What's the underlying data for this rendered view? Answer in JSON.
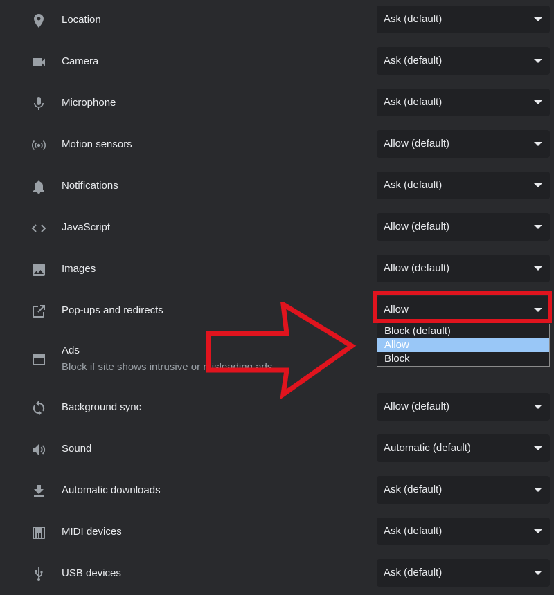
{
  "rows": [
    {
      "label": "Location",
      "value": "Ask (default)"
    },
    {
      "label": "Camera",
      "value": "Ask (default)"
    },
    {
      "label": "Microphone",
      "value": "Ask (default)"
    },
    {
      "label": "Motion sensors",
      "value": "Allow (default)"
    },
    {
      "label": "Notifications",
      "value": "Ask (default)"
    },
    {
      "label": "JavaScript",
      "value": "Allow (default)"
    },
    {
      "label": "Images",
      "value": "Allow (default)"
    },
    {
      "label": "Pop-ups and redirects",
      "value": "Allow"
    },
    {
      "label": "Ads",
      "sublabel": "Block if site shows intrusive or misleading ads"
    },
    {
      "label": "Background sync",
      "value": "Allow (default)"
    },
    {
      "label": "Sound",
      "value": "Automatic (default)"
    },
    {
      "label": "Automatic downloads",
      "value": "Ask (default)"
    },
    {
      "label": "MIDI devices",
      "value": "Ask (default)"
    },
    {
      "label": "USB devices",
      "value": "Ask (default)"
    }
  ],
  "popup_dropdown": {
    "options": [
      "Block (default)",
      "Allow",
      "Block"
    ],
    "selected": "Allow"
  },
  "icons": [
    "location-pin-icon",
    "camera-icon",
    "microphone-icon",
    "motion-sensors-icon",
    "bell-icon",
    "code-icon",
    "image-icon",
    "open-in-new-icon",
    "ads-window-icon",
    "sync-icon",
    "speaker-icon",
    "download-icon",
    "piano-icon",
    "usb-icon"
  ],
  "colors": {
    "background": "#292a2d",
    "select_bg": "#202124",
    "text": "#e8eaed",
    "muted": "#9aa0a6",
    "highlight": "#99c7f7",
    "annotation": "#e0141e"
  }
}
